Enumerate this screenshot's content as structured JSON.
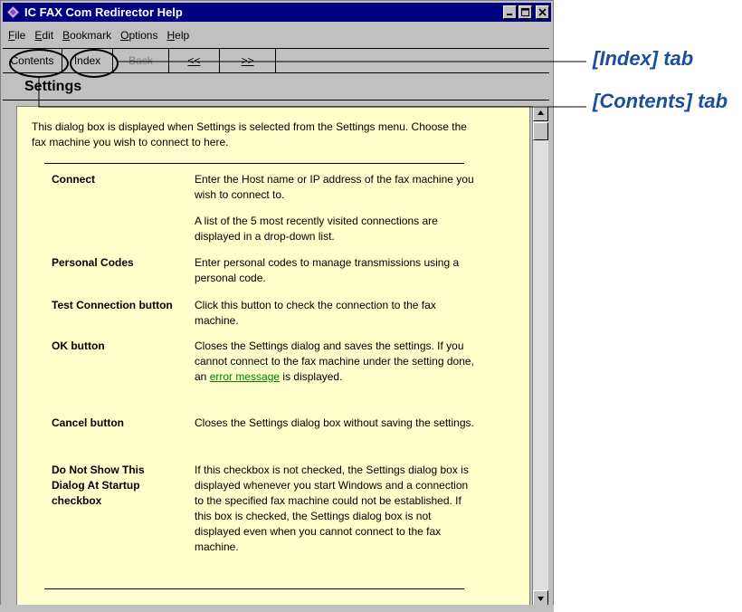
{
  "window": {
    "title": "IC FAX Com Redirector Help"
  },
  "menu": [
    "File",
    "Edit",
    "Bookmark",
    "Options",
    "Help"
  ],
  "menu_mnemonics": [
    "F",
    "E",
    "B",
    "O",
    "H"
  ],
  "toolbar": {
    "contents": "Contents",
    "index": "Index",
    "back": "Back",
    "prev": "<<",
    "next": ">>"
  },
  "topic": {
    "heading": "Settings",
    "intro": "This dialog box is displayed when Settings is selected from the Settings menu. Choose the fax machine you wish to connect to here."
  },
  "items": [
    {
      "term": "Connect",
      "desc": "Enter the Host name or IP address of the fax machine you wish to connect to.",
      "desc2": "A list of the 5 most recently visited connections are displayed in a drop-down list."
    },
    {
      "term": "Personal Codes",
      "desc": "Enter personal codes to manage transmissions using a personal code."
    },
    {
      "term": "Test Connection button",
      "desc": "Click this button to check the connection to the fax machine."
    },
    {
      "term": "OK  button",
      "desc_before": "Closes the Settings dialog and saves the settings. If you cannot connect to the fax machine under the setting done, an ",
      "link": "error message",
      "desc_after": " is displayed."
    },
    {
      "term": "Cancel  button",
      "desc": "Closes the Settings dialog box without saving the settings."
    },
    {
      "term": "Do Not Show This Dialog At Startup checkbox",
      "desc": "If this checkbox is not checked, the Settings dialog box is displayed whenever you start Windows and a connection to the specified fax machine could not be established. If this box is checked, the Settings dialog box is not displayed even when you cannot connect to the fax machine."
    }
  ],
  "callouts": {
    "index_tab": "[Index] tab",
    "contents_tab": "[Contents] tab"
  },
  "colors": {
    "titlebar": "#000080",
    "content_bg": "#ffffcc",
    "link": "#008000",
    "callout": "#1a4f9c"
  }
}
